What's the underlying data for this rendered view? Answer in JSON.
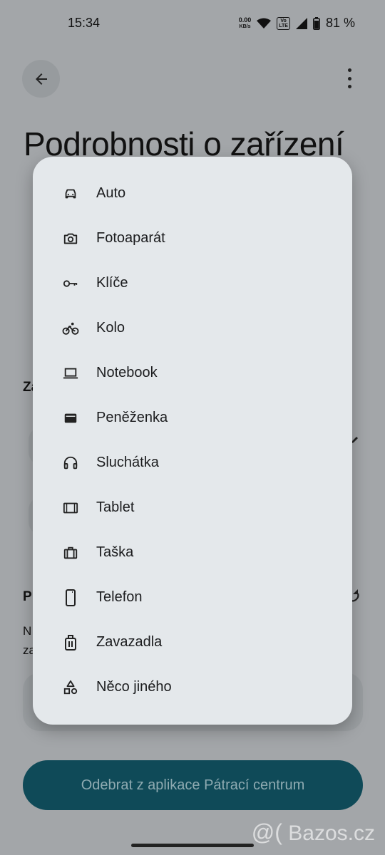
{
  "status_bar": {
    "time": "15:34",
    "net_speed_value": "0.00",
    "net_speed_unit": "KB/s",
    "volte_top": "Vo",
    "volte_bottom": "LTE",
    "battery": "81 %"
  },
  "page": {
    "title": "Podrobnosti o zařízení",
    "fragments": [
      "Za",
      "P",
      "N",
      "za"
    ],
    "remove_button": "Odebrat z aplikace Pátrací centrum"
  },
  "menu": {
    "items": [
      {
        "label": "Auto",
        "icon": "car-icon"
      },
      {
        "label": "Fotoaparát",
        "icon": "camera-icon"
      },
      {
        "label": "Klíče",
        "icon": "key-icon"
      },
      {
        "label": "Kolo",
        "icon": "bike-icon"
      },
      {
        "label": "Notebook",
        "icon": "laptop-icon"
      },
      {
        "label": "Peněženka",
        "icon": "wallet-icon"
      },
      {
        "label": "Sluchátka",
        "icon": "headphones-icon"
      },
      {
        "label": "Tablet",
        "icon": "tablet-icon"
      },
      {
        "label": "Taška",
        "icon": "bag-icon"
      },
      {
        "label": "Telefon",
        "icon": "phone-icon"
      },
      {
        "label": "Zavazadla",
        "icon": "luggage-icon"
      },
      {
        "label": "Něco jiného",
        "icon": "shapes-icon"
      }
    ]
  },
  "watermark": {
    "at": "@(",
    "text": "Bazos.cz"
  },
  "colors": {
    "scrim_bg": "#a3a6a9",
    "dialog_bg": "#e4e8eb",
    "primary_button": "#0f4a58",
    "primary_button_text": "#8eaab1"
  }
}
